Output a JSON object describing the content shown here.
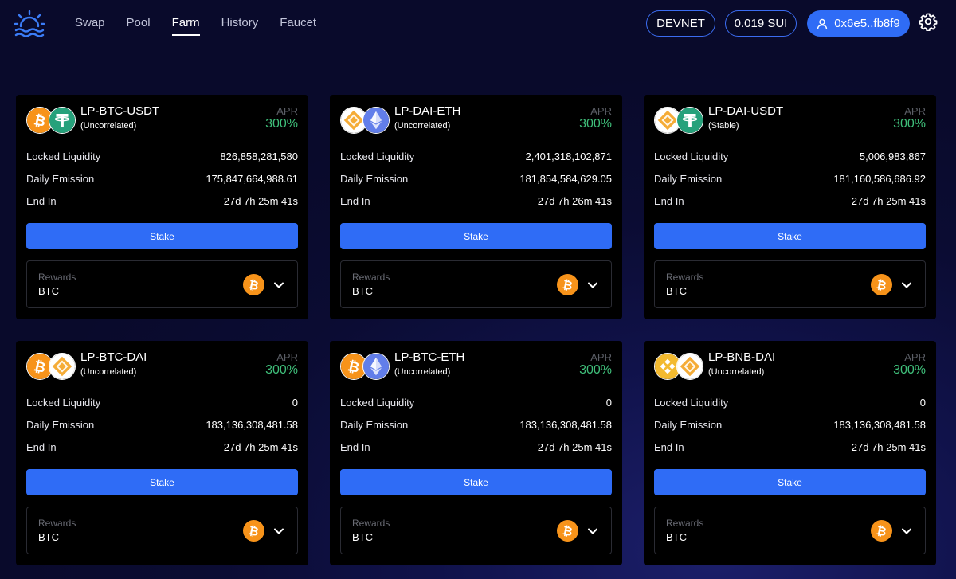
{
  "nav": {
    "items": [
      {
        "label": "Swap"
      },
      {
        "label": "Pool"
      },
      {
        "label": "Farm"
      },
      {
        "label": "History"
      },
      {
        "label": "Faucet"
      }
    ],
    "active": "Farm"
  },
  "header": {
    "network_label": "DEVNET",
    "balance_label": "0.019 SUI",
    "wallet_label": "0x6e5..fb8f9"
  },
  "icons": {
    "logo": "sun-over-waves-logo",
    "user": "user-icon",
    "settings": "gear-icon",
    "chevron": "chevron-down-icon"
  },
  "colors": {
    "accent": "#2f6cf6",
    "apr_green": "#3fbf7a",
    "btc": "#f7931a",
    "usdt": "#26a17b",
    "dai": "#f5ac37",
    "eth": "#627eea",
    "bnb": "#f3ba2f"
  },
  "cards": [
    {
      "name": "LP-BTC-USDT",
      "type": "(Uncorrelated)",
      "tokens": [
        "btc",
        "usdt"
      ],
      "apr_label": "APR",
      "apr": "300%",
      "locked_label": "Locked Liquidity",
      "locked": "826,858,281,580",
      "emission_label": "Daily Emission",
      "emission": "175,847,664,988.61",
      "end_label": "End In",
      "end": "27d 7h 25m 41s",
      "stake_label": "Stake",
      "rewards_label": "Rewards",
      "reward_token": "BTC"
    },
    {
      "name": "LP-DAI-ETH",
      "type": "(Uncorrelated)",
      "tokens": [
        "dai",
        "eth"
      ],
      "apr_label": "APR",
      "apr": "300%",
      "locked_label": "Locked Liquidity",
      "locked": "2,401,318,102,871",
      "emission_label": "Daily Emission",
      "emission": "181,854,584,629.05",
      "end_label": "End In",
      "end": "27d 7h 26m 41s",
      "stake_label": "Stake",
      "rewards_label": "Rewards",
      "reward_token": "BTC"
    },
    {
      "name": "LP-DAI-USDT",
      "type": "(Stable)",
      "tokens": [
        "dai",
        "usdt"
      ],
      "apr_label": "APR",
      "apr": "300%",
      "locked_label": "Locked Liquidity",
      "locked": "5,006,983,867",
      "emission_label": "Daily Emission",
      "emission": "181,160,586,686.92",
      "end_label": "End In",
      "end": "27d 7h 25m 41s",
      "stake_label": "Stake",
      "rewards_label": "Rewards",
      "reward_token": "BTC"
    },
    {
      "name": "LP-BTC-DAI",
      "type": "(Uncorrelated)",
      "tokens": [
        "btc",
        "dai"
      ],
      "apr_label": "APR",
      "apr": "300%",
      "locked_label": "Locked Liquidity",
      "locked": "0",
      "emission_label": "Daily Emission",
      "emission": "183,136,308,481.58",
      "end_label": "End In",
      "end": "27d 7h 25m 41s",
      "stake_label": "Stake",
      "rewards_label": "Rewards",
      "reward_token": "BTC"
    },
    {
      "name": "LP-BTC-ETH",
      "type": "(Uncorrelated)",
      "tokens": [
        "btc",
        "eth"
      ],
      "apr_label": "APR",
      "apr": "300%",
      "locked_label": "Locked Liquidity",
      "locked": "0",
      "emission_label": "Daily Emission",
      "emission": "183,136,308,481.58",
      "end_label": "End In",
      "end": "27d 7h 25m 41s",
      "stake_label": "Stake",
      "rewards_label": "Rewards",
      "reward_token": "BTC"
    },
    {
      "name": "LP-BNB-DAI",
      "type": "(Uncorrelated)",
      "tokens": [
        "bnb",
        "dai"
      ],
      "apr_label": "APR",
      "apr": "300%",
      "locked_label": "Locked Liquidity",
      "locked": "0",
      "emission_label": "Daily Emission",
      "emission": "183,136,308,481.58",
      "end_label": "End In",
      "end": "27d 7h 25m 41s",
      "stake_label": "Stake",
      "rewards_label": "Rewards",
      "reward_token": "BTC"
    }
  ]
}
